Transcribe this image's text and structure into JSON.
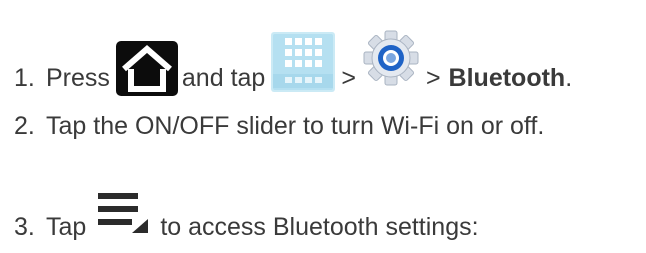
{
  "steps": [
    {
      "number": "1.",
      "text_before": "Press",
      "text_middle": "and tap",
      "separator_1": ">",
      "separator_2": ">",
      "target": "Bluetooth",
      "end": ".",
      "icons": [
        "home-icon",
        "apps-icon",
        "settings-gear-icon"
      ]
    },
    {
      "number": "2.",
      "text": "Tap the ON/OFF slider to turn Wi-Fi on or off."
    },
    {
      "number": "3.",
      "text_before": "Tap",
      "text_after": "to access Bluetooth settings:",
      "icons": [
        "menu-icon"
      ]
    }
  ],
  "colors": {
    "text": "#3a3a3a",
    "home_icon_bg": "#0c0c0c",
    "apps_icon_bg": "#b9e3f3",
    "gear_blue": "#1f63c6"
  }
}
